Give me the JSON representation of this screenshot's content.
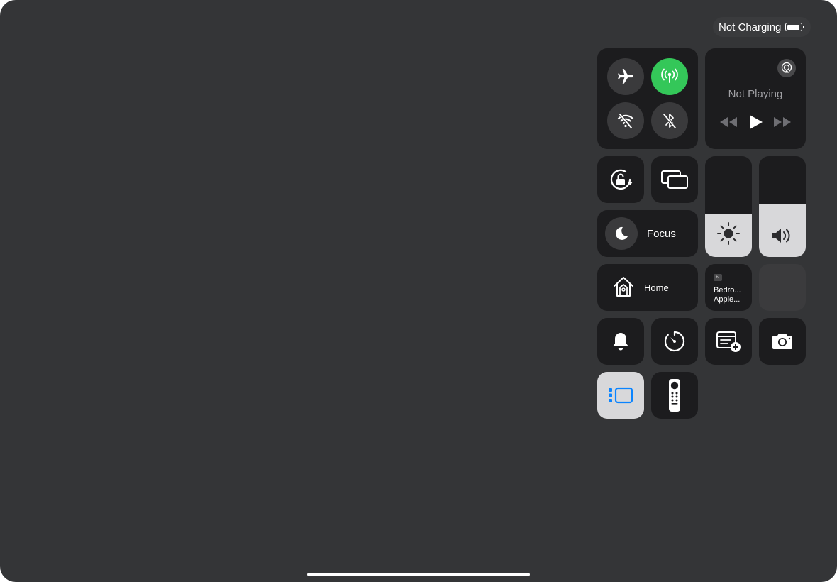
{
  "status_bar": {
    "battery_label": "Not Charging",
    "battery_level": 0.9
  },
  "connectivity": {
    "airplane_icon": "airplane-icon",
    "cellular_icon": "cellular-antenna-icon",
    "wifi_icon": "wifi-off-icon",
    "bluetooth_icon": "bluetooth-off-icon",
    "cellular_color": "#34c759"
  },
  "now_playing": {
    "title": "Not Playing",
    "airplay_icon": "airplay-icon",
    "controls": [
      "rewind-icon",
      "play-icon",
      "fast-forward-icon"
    ]
  },
  "controls": {
    "rotation_lock_icon": "rotation-lock-icon",
    "screen_mirroring_icon": "screen-mirroring-icon",
    "focus_label": "Focus",
    "focus_icon": "moon-icon",
    "home_label": "Home",
    "home_icon": "home-icon",
    "apple_tv_badge": "tv",
    "apple_tv_line1": "Bedro...",
    "apple_tv_line2": "Apple...",
    "silent_icon": "bell-icon",
    "timer_icon": "timer-icon",
    "quick_note_icon": "quick-note-icon",
    "camera_icon": "camera-icon",
    "stage_manager_icon": "stage-manager-icon",
    "remote_icon": "apple-tv-remote-icon"
  },
  "sliders": {
    "brightness": 0.43,
    "brightness_icon": "sun-icon",
    "volume": 0.52,
    "volume_icon": "speaker-icon"
  },
  "colors": {
    "background": "#343537",
    "tile": "#1c1c1e",
    "active_tile": "#d8d8da",
    "accent_blue": "#0a84ff",
    "accent_green": "#34c759"
  }
}
